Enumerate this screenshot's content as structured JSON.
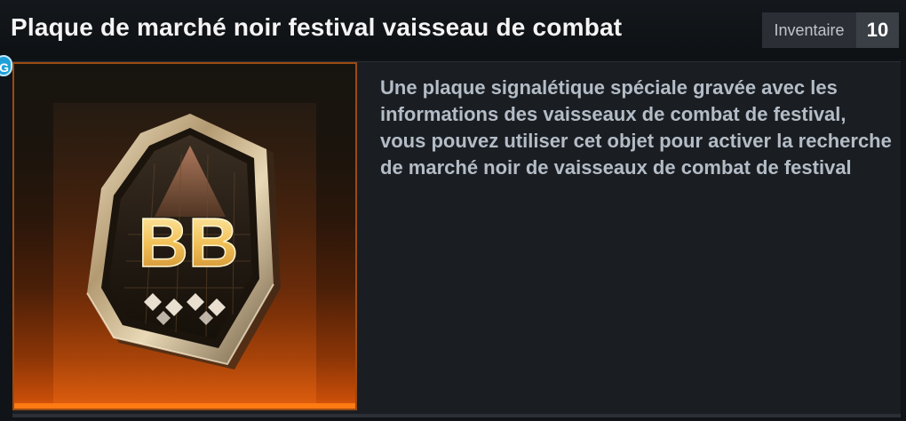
{
  "item": {
    "title": "Plaque de marché noir festival vaisseau de combat",
    "icon_label": "BB",
    "description": "Une plaque signalétique spéciale gravée avec les informations des vaisseaux de combat de festival, vous pouvez utiliser cet objet pour activer la recherche de marché noir de vaisseaux de combat de festival"
  },
  "inventory": {
    "label": "Inventaire",
    "count": "10"
  },
  "badge": {
    "letter": "G"
  },
  "colors": {
    "rarity_accent": "#ff7a12",
    "badge_blue": "#1fa0d8"
  }
}
